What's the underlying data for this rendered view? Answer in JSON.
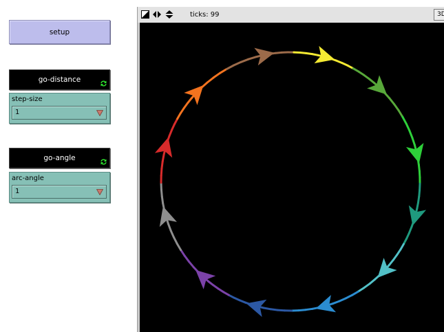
{
  "setup_button": {
    "label": "setup"
  },
  "go_distance_button": {
    "label": "go-distance"
  },
  "step_size": {
    "label": "step-size",
    "value": "1"
  },
  "go_angle_button": {
    "label": "go-angle"
  },
  "arc_angle": {
    "label": "arc-angle",
    "value": "1"
  },
  "view": {
    "ticks_label": "ticks: 99",
    "three_d_label": "3D",
    "toolbar_icons": [
      "resize-icon",
      "horizontal-arrows-icon",
      "vertical-arrows-icon"
    ],
    "turtles": [
      {
        "color": "#9c6b4a",
        "heading": 78
      },
      {
        "color": "#f5ea33",
        "heading": 105
      },
      {
        "color": "#58a83a",
        "heading": 133
      },
      {
        "color": "#2ecf3a",
        "heading": 167
      },
      {
        "color": "#1f9a7e",
        "heading": 195
      },
      {
        "color": "#52c0c7",
        "heading": 223
      },
      {
        "color": "#2b8cd0",
        "heading": 254
      },
      {
        "color": "#2c58a4",
        "heading": 285
      },
      {
        "color": "#7b42a8",
        "heading": 312
      },
      {
        "color": "#8e8e8e",
        "heading": 344
      },
      {
        "color": "#d82b2b",
        "heading": 15
      },
      {
        "color": "#f3731f",
        "heading": 43
      }
    ],
    "colors": {
      "world_background": "#000000",
      "button_background": "#bdbdec",
      "chooser_background": "#86c0b6",
      "forever_icon": "#2ee62e"
    }
  }
}
